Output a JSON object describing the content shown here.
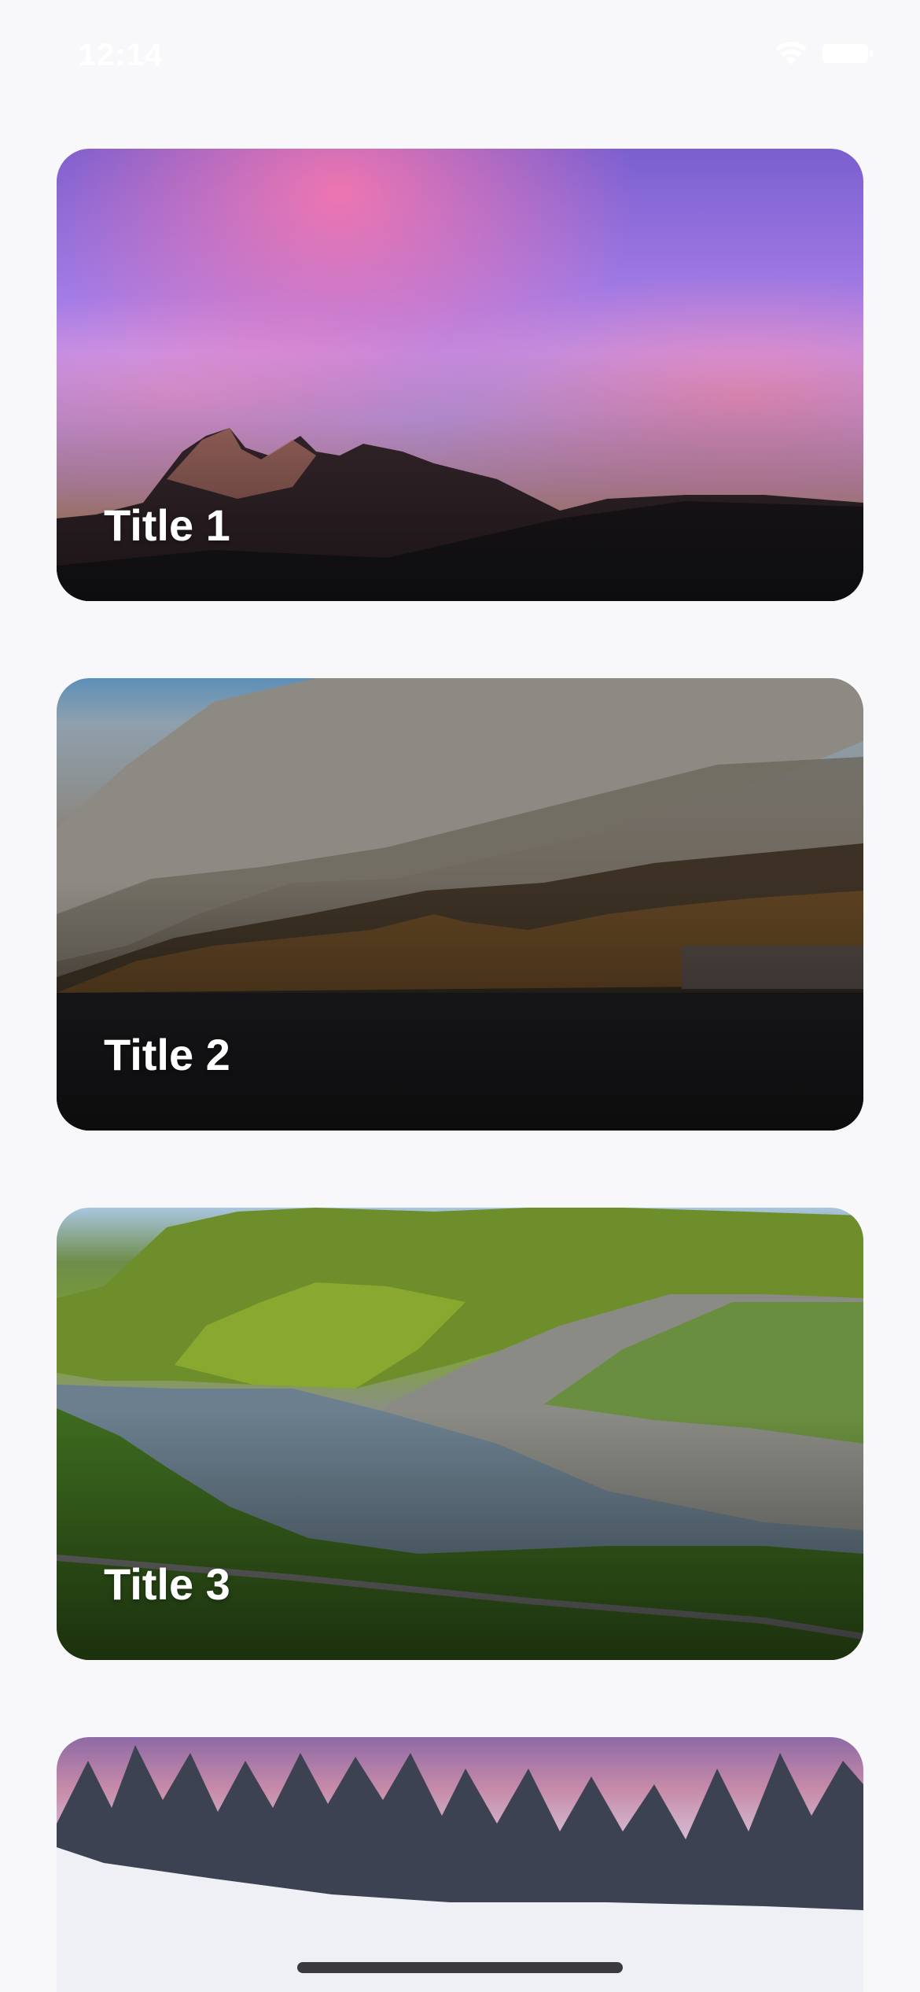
{
  "status_bar": {
    "time": "12:14",
    "wifi_icon": "wifi-icon",
    "battery_icon": "battery-icon"
  },
  "cards": [
    {
      "title": "Title 1",
      "image": "mountain-sunset"
    },
    {
      "title": "Title 2",
      "image": "mountain-lake-dusk"
    },
    {
      "title": "Title 3",
      "image": "green-fjord-valley"
    },
    {
      "title": "",
      "image": "snowy-forest"
    }
  ],
  "colors": {
    "background": "#f8f8fa",
    "title_text": "#ffffff",
    "home_indicator": "#3a3a3c"
  }
}
